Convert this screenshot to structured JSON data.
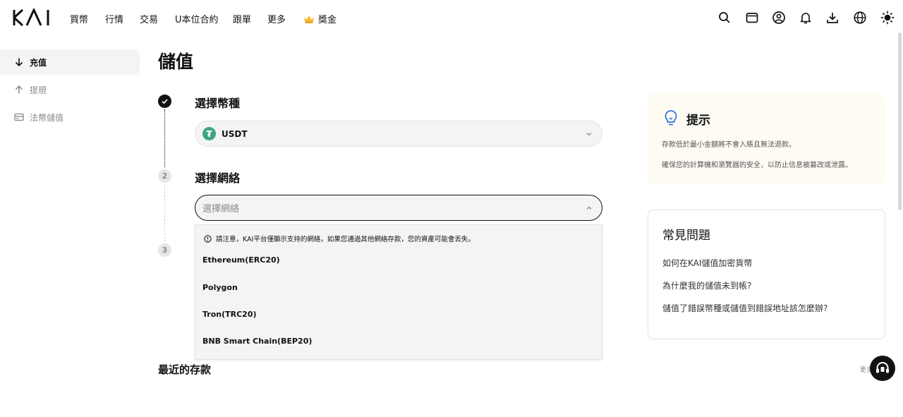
{
  "brand": {
    "logo_text": "KAI"
  },
  "nav": {
    "items": [
      "買幣",
      "行情",
      "交易",
      "U本位合約",
      "跟單",
      "更多"
    ],
    "rewards_label": "獎金"
  },
  "header_icons": [
    "search-icon",
    "wallet-icon",
    "user-icon",
    "bell-icon",
    "download-icon",
    "globe-icon",
    "theme-icon"
  ],
  "sidebar": {
    "items": [
      {
        "label": "充值",
        "icon": "arrow-down-icon",
        "active": true
      },
      {
        "label": "提現",
        "icon": "arrow-up-icon",
        "active": false
      },
      {
        "label": "法幣儲值",
        "icon": "card-icon",
        "active": false
      }
    ]
  },
  "page": {
    "title": "儲值"
  },
  "steps": {
    "step1": {
      "title": "選擇幣種",
      "selected_coin": "USDT",
      "coin_symbol": "₮"
    },
    "step2": {
      "number": "2",
      "title": "選擇網絡",
      "placeholder": "選擇網絡"
    },
    "step3": {
      "number": "3"
    }
  },
  "dropdown": {
    "notice": "請注意，KAI平台僅顯示支持的網絡，如果您通過其他網絡存款，您的資產可能會丟失。",
    "options": [
      "Ethereum(ERC20)",
      "Polygon",
      "Tron(TRC20)",
      "BNB Smart Chain(BEP20)"
    ]
  },
  "recent": {
    "title": "最近的存款",
    "more": "更多"
  },
  "tips": {
    "title": "提示",
    "lines": [
      "存款低於最小金額將不會入賬且無法退款。",
      "確保您的計算機和瀏覽器的安全，以防止信息被篡改或泄露。"
    ]
  },
  "faq": {
    "title": "常見問題",
    "items": [
      "如何在KAI儲值加密貨幣",
      "為什麼我的儲值未到帳?",
      "儲值了錯誤幣種或儲值到錯誤地址該怎麼辦?"
    ]
  },
  "colors": {
    "accent": "#121212",
    "usdt": "#3fa584",
    "tips_bg": "#fefbf3",
    "bulb": "#2f6fe0"
  }
}
